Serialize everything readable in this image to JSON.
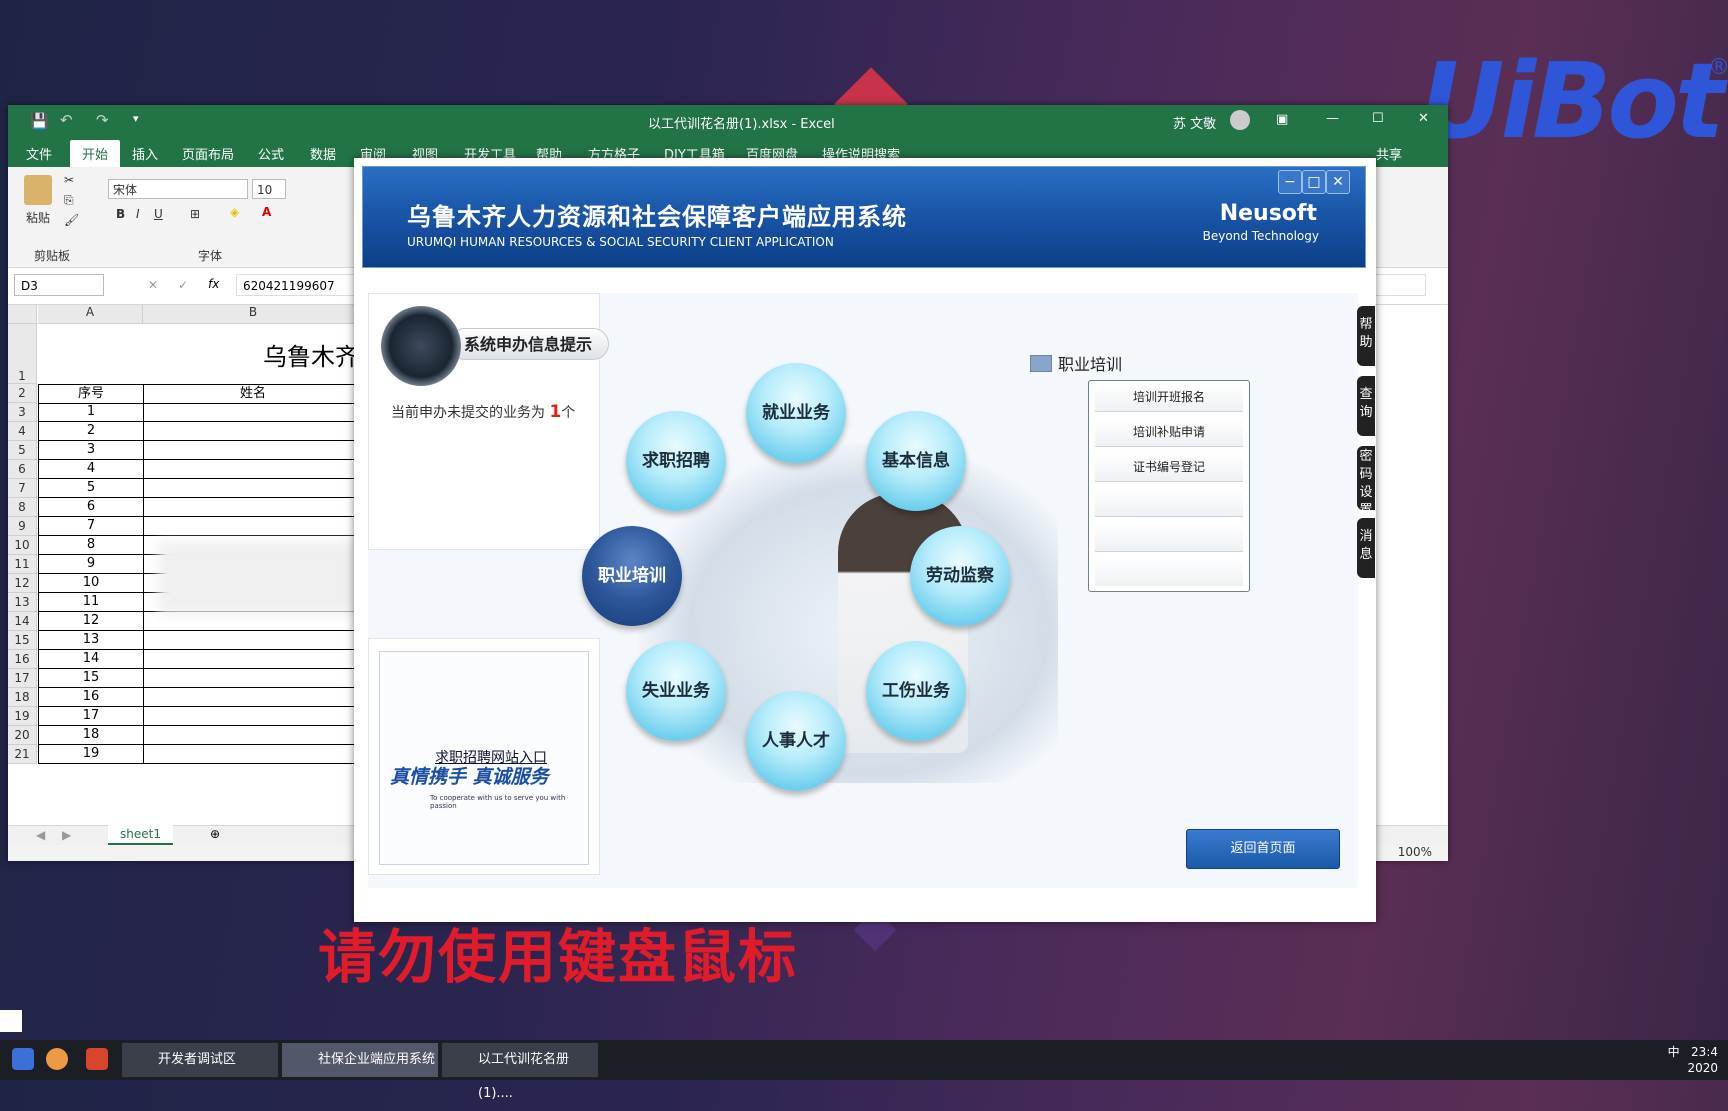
{
  "desktop": {
    "brand": "UiBot",
    "warning": "请勿使用键盘鼠标"
  },
  "excel": {
    "title": "以工代训花名册(1).xlsx  -  Excel",
    "user": "苏 文敬",
    "menus": [
      "文件",
      "开始",
      "插入",
      "页面布局",
      "公式",
      "数据",
      "审阅",
      "视图",
      "开发工具",
      "帮助",
      "方方格子",
      "DIY工具箱",
      "百度网盘",
      "操作说明搜索"
    ],
    "share": "共享",
    "font_name": "宋体",
    "font_size": "10",
    "group_clipboard": "剪贴板",
    "group_font": "字体",
    "paste": "粘贴",
    "name_box": "D3",
    "formula": "620421199607",
    "col_a": "A",
    "col_b": "B",
    "sheet_title": "乌鲁木齐",
    "header_a": "序号",
    "header_b": "姓名",
    "row_numbers": [
      "1",
      "2",
      "3",
      "4",
      "5",
      "6",
      "7",
      "8",
      "9",
      "10",
      "11",
      "12",
      "13",
      "14",
      "15",
      "16",
      "17",
      "18",
      "19",
      "20",
      "21"
    ],
    "seq": [
      "1",
      "2",
      "3",
      "4",
      "5",
      "6",
      "7",
      "8",
      "9",
      "10",
      "11",
      "12",
      "13",
      "14",
      "15",
      "16",
      "17",
      "18",
      "19"
    ],
    "sheet_tab": "sheet1",
    "zoom": "100%"
  },
  "app": {
    "title_cn": "乌鲁木齐人力资源和社会保障客户端应用系统",
    "title_en": "URUMQI HUMAN RESOURCES & SOCIAL SECURITY CLIENT APPLICATION",
    "brand": "Neusoft",
    "slogan": "Beyond Technology",
    "notice_title": "系统申办信息提示",
    "pending_prefix": "当前申办未提交的业务为",
    "pending_count": "1",
    "pending_unit": "个",
    "ad_link": "求职招聘网站入口",
    "ad_logo": "真情携手 真诚服务",
    "ad_small": "To cooperate with us  to serve you with passion",
    "circles": {
      "jiuye": "就业业务",
      "qiuzhi": "求职招聘",
      "jiben": "基本信息",
      "zhiye": "职业培训",
      "laodong": "劳动监察",
      "shiye": "失业业务",
      "gongshang": "工伤业务",
      "renshi": "人事人才"
    },
    "section_title": "职业培训",
    "training_items": [
      "培训开班报名",
      "培训补贴申请",
      "证书编号登记"
    ],
    "back_button": "返回首页面",
    "side_tabs": [
      "帮助",
      "查询",
      "密码设置",
      "消息"
    ]
  },
  "taskbar": {
    "items": [
      "开发者调试区",
      "社保企业端应用系统",
      "以工代训花名册(1)...."
    ],
    "time": "23:4",
    "date": "2020",
    "ime": "中"
  }
}
